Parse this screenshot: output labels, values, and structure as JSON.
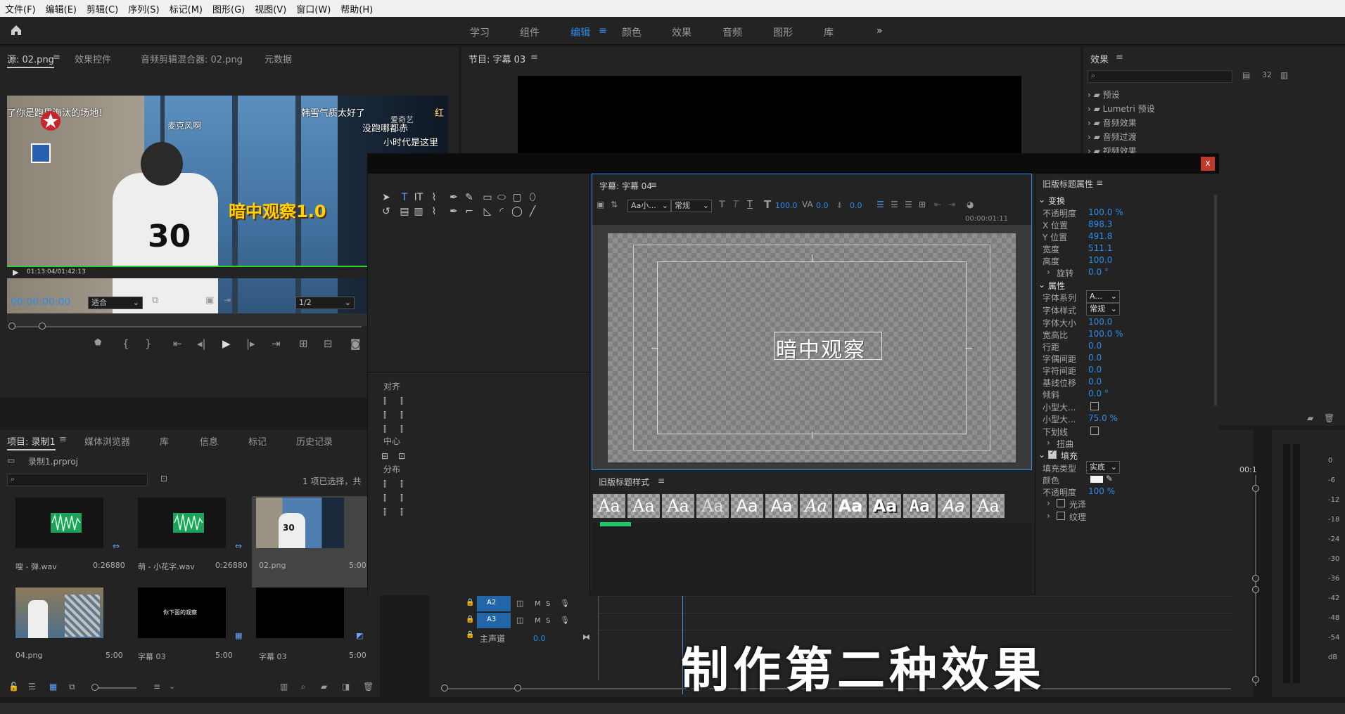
{
  "menu": [
    "文件(F)",
    "编辑(E)",
    "剪辑(C)",
    "序列(S)",
    "标记(M)",
    "图形(G)",
    "视图(V)",
    "窗口(W)",
    "帮助(H)"
  ],
  "workspaces": [
    "学习",
    "组件",
    "编辑",
    "颜色",
    "效果",
    "音频",
    "图形",
    "库"
  ],
  "workspace_active": "编辑",
  "source": {
    "tabs": [
      "源: 02.png",
      "效果控件",
      "音频剪辑混合器: 02.png",
      "元数据"
    ],
    "overlay_text": [
      "了你是跑男海汰的场地！",
      "韩雪气质太好了",
      "没跑哪都赤",
      "红",
      "麦克风啊",
      "小时代是这里",
      "暗中观察1.0",
      "爱奇艺"
    ],
    "jersey": "30",
    "timecode_small": "01:13:04/01:42:13",
    "timecode": "00:00:00:00",
    "fit": "适合",
    "fraction": "1/2"
  },
  "program": {
    "tab": "节目: 字幕 03"
  },
  "effects": {
    "tab": "效果",
    "items": [
      "预设",
      "Lumetri 预设",
      "音频效果",
      "音频过渡",
      "视频效果"
    ]
  },
  "project": {
    "tabs": [
      "项目: 录制1",
      "媒体浏览器",
      "库",
      "信息",
      "标记",
      "历史记录"
    ],
    "file": "录制1.prproj",
    "selection": "1 项已选择，共",
    "items": [
      {
        "name": "嗖 - 弹.wav",
        "dur": "0:26880"
      },
      {
        "name": "萌 - 小花字.wav",
        "dur": "0:26880"
      },
      {
        "name": "02.png",
        "dur": "5:00"
      },
      {
        "name": "04.png",
        "dur": "5:00"
      },
      {
        "name": "字幕 03",
        "dur": "5:00"
      },
      {
        "name": "字幕 03",
        "dur": "5:00"
      }
    ],
    "thumb_text": "你下面的观察"
  },
  "title_dialog": {
    "close": "x",
    "title_tab": "字幕: 字幕 04",
    "font_family": "Aa小...",
    "font_style": "常规",
    "font_size": "100.0",
    "kerning": "0.0",
    "leading": "0.0",
    "timecode": "00:00:01:11",
    "canvas_text": "暗中观察",
    "align_label": "对齐",
    "center_label": "中心",
    "distribute_label": "分布",
    "styles_tab": "旧版标题样式",
    "style_samples": [
      "Aa",
      "Aa",
      "Aa",
      "Aa",
      "Aa",
      "Aa",
      "Aa",
      "Aa",
      "Aa",
      "Aa",
      "Aa",
      "Aa"
    ],
    "props_tab": "旧版标题属性",
    "transform": "变换",
    "props": [
      {
        "k": "不透明度",
        "v": "100.0 %"
      },
      {
        "k": "X 位置",
        "v": "898.3"
      },
      {
        "k": "Y 位置",
        "v": "491.8"
      },
      {
        "k": "宽度",
        "v": "511.1"
      },
      {
        "k": "高度",
        "v": "100.0"
      }
    ],
    "rotate": "旋转",
    "rotate_v": "0.0 °",
    "attributes": "属性",
    "attr": [
      {
        "k": "字体系列",
        "v": "A..."
      },
      {
        "k": "字体样式",
        "v": "常规"
      },
      {
        "k": "字体大小",
        "v": "100.0"
      },
      {
        "k": "宽高比",
        "v": "100.0 %"
      },
      {
        "k": "行距",
        "v": "0.0"
      },
      {
        "k": "字偶间距",
        "v": "0.0"
      },
      {
        "k": "字符间距",
        "v": "0.0"
      },
      {
        "k": "基线位移",
        "v": "0.0"
      },
      {
        "k": "倾斜",
        "v": "0.0 °"
      },
      {
        "k": "小型大...",
        "v": ""
      },
      {
        "k": "小型大...",
        "v": "75.0 %"
      },
      {
        "k": "下划线",
        "v": ""
      }
    ],
    "distort": "扭曲",
    "fill": "填充",
    "fill_type_k": "填充类型",
    "fill_type_v": "实底",
    "color_k": "颜色",
    "opacity_k": "不透明度",
    "opacity_v": "100 %",
    "sheen": "光泽",
    "texture": "纹理"
  },
  "timeline": {
    "tracks": [
      {
        "id": "A2",
        "m": "M",
        "s": "S"
      },
      {
        "id": "A3",
        "m": "M",
        "s": "S"
      }
    ],
    "master": "主声道",
    "master_v": "0.0",
    "time_label": "00:1"
  },
  "meter_scale": [
    "0",
    "-6",
    "-12",
    "-18",
    "-24",
    "-30",
    "-36",
    "-42",
    "-48",
    "-54",
    "dB"
  ],
  "caption": "制作第二种效果"
}
